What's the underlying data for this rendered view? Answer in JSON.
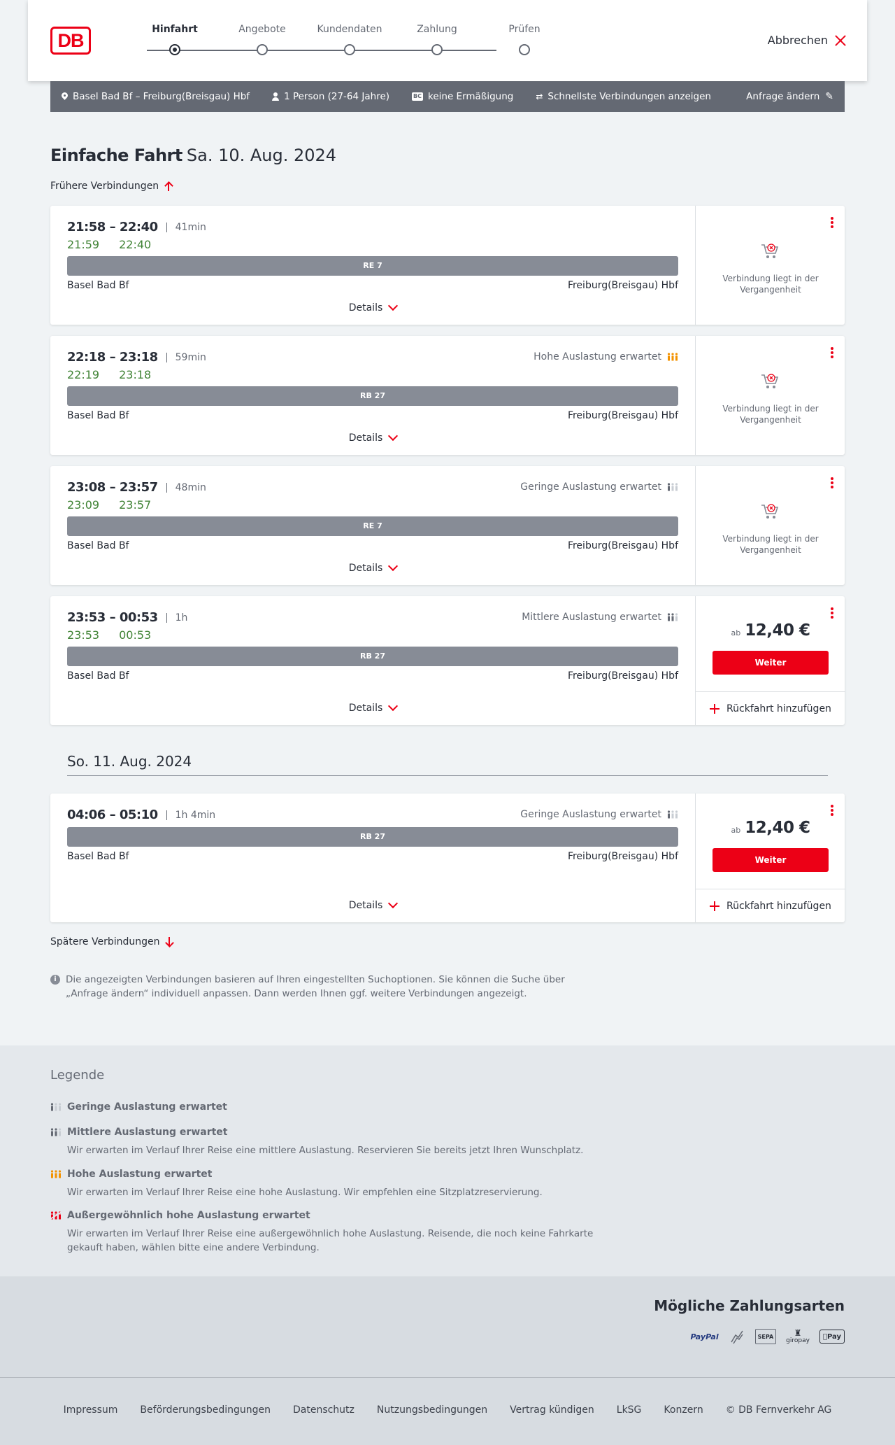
{
  "header": {
    "logo": "DB",
    "steps": [
      {
        "label": "Hinfahrt",
        "active": true
      },
      {
        "label": "Angebote",
        "active": false
      },
      {
        "label": "Kundendaten",
        "active": false
      },
      {
        "label": "Zahlung",
        "active": false
      },
      {
        "label": "Prüfen",
        "active": false
      }
    ],
    "cancel_label": "Abbrechen"
  },
  "searchbar": {
    "route": "Basel Bad Bf – Freiburg(Breisgau) Hbf",
    "travellers": "1 Person (27-64 Jahre)",
    "bc_badge": "BC",
    "discount": "keine Ermäßigung",
    "option": "Schnellste Verbindungen anzeigen",
    "change_label": "Anfrage ändern"
  },
  "page": {
    "title_bold": "Einfache Fahrt",
    "title_date": "Sa. 10. Aug. 2024",
    "earlier_label": "Frühere Verbindungen",
    "later_label": "Spätere Verbindungen",
    "day2_label": "So. 11. Aug. 2024",
    "info_text": "Die angezeigten Verbindungen basieren auf Ihren eingestellten Suchoptionen. Sie können die Suche über „Anfrage ändern“ individuell anpassen. Dann werden Ihnen ggf. weitere Verbindungen angezeigt."
  },
  "connections": [
    {
      "times": "21:58 – 22:40",
      "duration": "41min",
      "rt_dep": "21:59",
      "rt_arr": "22:40",
      "load": "",
      "train": "RE 7",
      "from": "Basel Bad Bf",
      "to": "Freiburg(Breisgau) Hbf",
      "details": "Details",
      "past_text": "Verbindung liegt in der Vergangenheit"
    },
    {
      "times": "22:18 – 23:18",
      "duration": "59min",
      "rt_dep": "22:19",
      "rt_arr": "23:18",
      "load": "Hohe Auslastung erwartet",
      "load_level": 3,
      "train": "RB 27",
      "from": "Basel Bad Bf",
      "to": "Freiburg(Breisgau) Hbf",
      "details": "Details",
      "past_text": "Verbindung liegt in der Vergangenheit"
    },
    {
      "times": "23:08 – 23:57",
      "duration": "48min",
      "rt_dep": "23:09",
      "rt_arr": "23:57",
      "load": "Geringe Auslastung erwartet",
      "load_level": 1,
      "train": "RE 7",
      "from": "Basel Bad Bf",
      "to": "Freiburg(Breisgau) Hbf",
      "details": "Details",
      "past_text": "Verbindung liegt in der Vergangenheit"
    },
    {
      "times": "23:53 – 00:53",
      "duration": "1h",
      "rt_dep": "23:53",
      "rt_arr": "00:53",
      "load": "Mittlere Auslastung erwartet",
      "load_level": 2,
      "train": "RB 27",
      "from": "Basel Bad Bf",
      "to": "Freiburg(Breisgau) Hbf",
      "details": "Details",
      "price_prefix": "ab",
      "price": "12,40 €",
      "button": "Weiter",
      "return_label": "Rückfahrt hinzufügen"
    },
    {
      "times": "04:06 – 05:10",
      "duration": "1h 4min",
      "load": "Geringe Auslastung erwartet",
      "load_level": 1,
      "train": "RB 27",
      "from": "Basel Bad Bf",
      "to": "Freiburg(Breisgau) Hbf",
      "details": "Details",
      "price_prefix": "ab",
      "price": "12,40 €",
      "button": "Weiter",
      "return_label": "Rückfahrt hinzufügen"
    }
  ],
  "legend": {
    "title": "Legende",
    "items": [
      {
        "label": "Geringe Auslastung erwartet",
        "desc": ""
      },
      {
        "label": "Mittlere Auslastung erwartet",
        "desc": "Wir erwarten im Verlauf Ihrer Reise eine mittlere Auslastung. Reservieren Sie bereits jetzt Ihren Wunschplatz."
      },
      {
        "label": "Hohe Auslastung erwartet",
        "desc": "Wir erwarten im Verlauf Ihrer Reise eine hohe Auslastung. Wir empfehlen eine Sitzplatzreservierung."
      },
      {
        "label": "Außergewöhnlich hohe Auslastung erwartet",
        "desc": "Wir erwarten im Verlauf Ihrer Reise eine außergewöhnlich hohe Auslastung. Reisende, die noch keine Fahrkarte gekauft haben, wählen bitte eine andere Verbindung."
      }
    ]
  },
  "payment": {
    "title": "Mögliche Zahlungsarten",
    "methods": [
      "PayPal",
      "SEPA",
      "giropay",
      "Pay"
    ]
  },
  "footer": {
    "links": [
      "Impressum",
      "Beförderungsbedingungen",
      "Datenschutz",
      "Nutzungsbedingungen",
      "Vertrag kündigen",
      "LkSG",
      "Konzern",
      "© DB Fernverkehr AG"
    ]
  },
  "colors": {
    "brand_red": "#ec0016",
    "realtime_green": "#408335",
    "bar_grey": "#878c96",
    "high_load_orange": "#f39200"
  }
}
